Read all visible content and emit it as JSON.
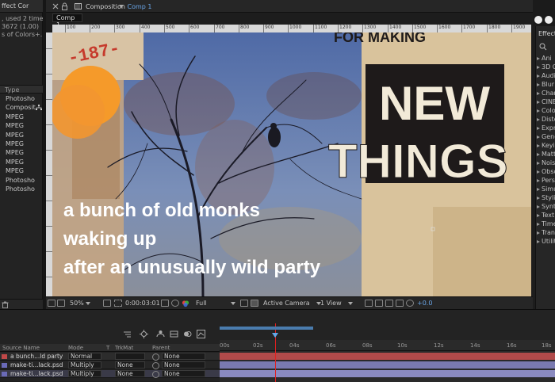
{
  "project": {
    "tab_label": "ffect Cor",
    "info_lines": [
      ", used 2 times",
      "3672 (1.00)",
      "s of Colors+..."
    ],
    "col_type": "Type",
    "items": [
      "Photosho",
      "Composit",
      "MPEG",
      "MPEG",
      "MPEG",
      "MPEG",
      "MPEG",
      "MPEG",
      "MPEG",
      "Photosho",
      "Photosho"
    ]
  },
  "composition": {
    "tab_prefix": "Composition",
    "tab_name": "Comp 1",
    "subtab": "Comp 1",
    "ruler_ticks": [
      "100",
      "200",
      "300",
      "400",
      "500",
      "600",
      "700",
      "800",
      "900",
      "1000",
      "1100",
      "1200",
      "1300",
      "1400",
      "1500",
      "1600",
      "1700",
      "1800",
      "1900"
    ],
    "overlay_lines": [
      "a bunch of old monks",
      "waking up",
      "after an unusually wild party"
    ],
    "poster_lines": [
      "FOR MAKING",
      "NEW",
      "THINGS"
    ],
    "sign_text": "-187-"
  },
  "comp_footer": {
    "zoom": "50%",
    "timecode": "0:00:03:01",
    "resolution": "Full",
    "camera": "Active Camera",
    "view": "1 View",
    "exposure": "+0.0"
  },
  "effects": {
    "title": "Effects",
    "items": [
      "Ani",
      "3D C",
      "Audi",
      "Blur",
      "Chan",
      "CINE",
      "Colo",
      "Disto",
      "Expre",
      "Gene",
      "Keyin",
      "Matte",
      "Noise",
      "Obso",
      "Persp",
      "Simu",
      "Styliz",
      "Synth",
      "Text",
      "Time",
      "Trans",
      "Utilit"
    ]
  },
  "timeline": {
    "col_headers": {
      "source": "Source Name",
      "mode": "Mode",
      "t": "T",
      "trkmat": "TrkMat",
      "parent": "Parent"
    },
    "layers": [
      {
        "name": "a bunch...ld party",
        "mode": "Normal",
        "trkmat": "",
        "parent": "None",
        "color": "#c04848"
      },
      {
        "name": "make-ti...lack.psd",
        "mode": "Multiply",
        "trkmat": "None",
        "parent": "None",
        "color": "#6a6ab8"
      },
      {
        "name": "make-ti...lack.psd",
        "mode": "Multiply",
        "trkmat": "None",
        "parent": "None",
        "color": "#6a6ab8"
      }
    ],
    "time_ticks": [
      "00s",
      "02s",
      "04s",
      "06s",
      "08s",
      "10s",
      "12s",
      "14s",
      "16s",
      "18s"
    ],
    "playhead_seconds": 3.03
  }
}
